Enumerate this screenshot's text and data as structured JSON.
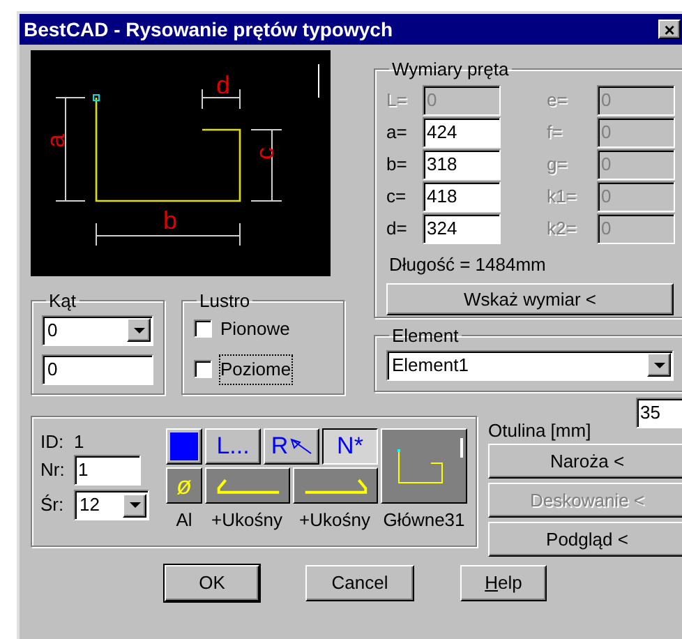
{
  "window": {
    "title": "BestCAD - Rysowanie prętów typowych",
    "close": "×"
  },
  "preview": {
    "dimension_labels": [
      {
        "kind": "vertical",
        "text": "a"
      },
      {
        "kind": "horizontal",
        "text": "b"
      },
      {
        "kind": "vertical-right",
        "text": "c"
      },
      {
        "kind": "top",
        "text": "d"
      }
    ]
  },
  "dimensions": {
    "title": "Wymiary pręta",
    "left": [
      {
        "label": "L=",
        "value": "0",
        "disabled": true
      },
      {
        "label": "a=",
        "value": "424",
        "disabled": false
      },
      {
        "label": "b=",
        "value": "318",
        "disabled": false
      },
      {
        "label": "c=",
        "value": "418",
        "disabled": false
      },
      {
        "label": "d=",
        "value": "324",
        "disabled": false
      }
    ],
    "right": [
      {
        "label": "e=",
        "value": "0",
        "disabled": true
      },
      {
        "label": "f=",
        "value": "0",
        "disabled": true
      },
      {
        "label": "g=",
        "value": "0",
        "disabled": true
      },
      {
        "label": "k1=",
        "value": "0",
        "disabled": true
      },
      {
        "label": "k2=",
        "value": "0",
        "disabled": true
      }
    ],
    "length": "Długość = 1484mm",
    "button": "Wskaż wymiar <"
  },
  "angle": {
    "title": "Kąt",
    "combo": "0",
    "field": "0"
  },
  "mirror": {
    "title": "Lustro",
    "checkboxes": [
      {
        "label": "Pionowe",
        "checked": false,
        "focused": false
      },
      {
        "label": "Poziome",
        "checked": false,
        "focused": true
      }
    ]
  },
  "element": {
    "title": "Element",
    "combo": "Element1"
  },
  "bar": {
    "id_label": "ID:",
    "id_value": "1",
    "nr_label": "Nr:",
    "nr_value": "1",
    "sr_label": "Śr:",
    "sr_value": "12",
    "tools": [
      {
        "kind": "color",
        "selected": false
      },
      {
        "kind": "text",
        "text": "L...",
        "selected": false
      },
      {
        "kind": "text-arrow",
        "text": "R",
        "selected": false
      },
      {
        "kind": "text",
        "text": "N*",
        "selected": true
      },
      {
        "kind": "symbol",
        "text": "ø",
        "selected": false
      },
      {
        "kind": "hook-left",
        "selected": false
      },
      {
        "kind": "hook-right",
        "selected": false
      }
    ],
    "captions": [
      "Al",
      "+Ukośny",
      "+Ukośny",
      "Główne31"
    ]
  },
  "cover": {
    "label": "Otulina [mm]",
    "value": "35"
  },
  "side_buttons": [
    {
      "label": "Naroża <",
      "disabled": false
    },
    {
      "label": "Deskowanie <",
      "disabled": true
    },
    {
      "label": "Podgląd <",
      "disabled": false
    }
  ],
  "dialog_buttons": [
    {
      "label": "OK",
      "default": true,
      "underline_first": false
    },
    {
      "label": "Cancel",
      "default": false,
      "underline_first": false
    },
    {
      "label": "Help",
      "default": false,
      "underline_first": true
    }
  ]
}
